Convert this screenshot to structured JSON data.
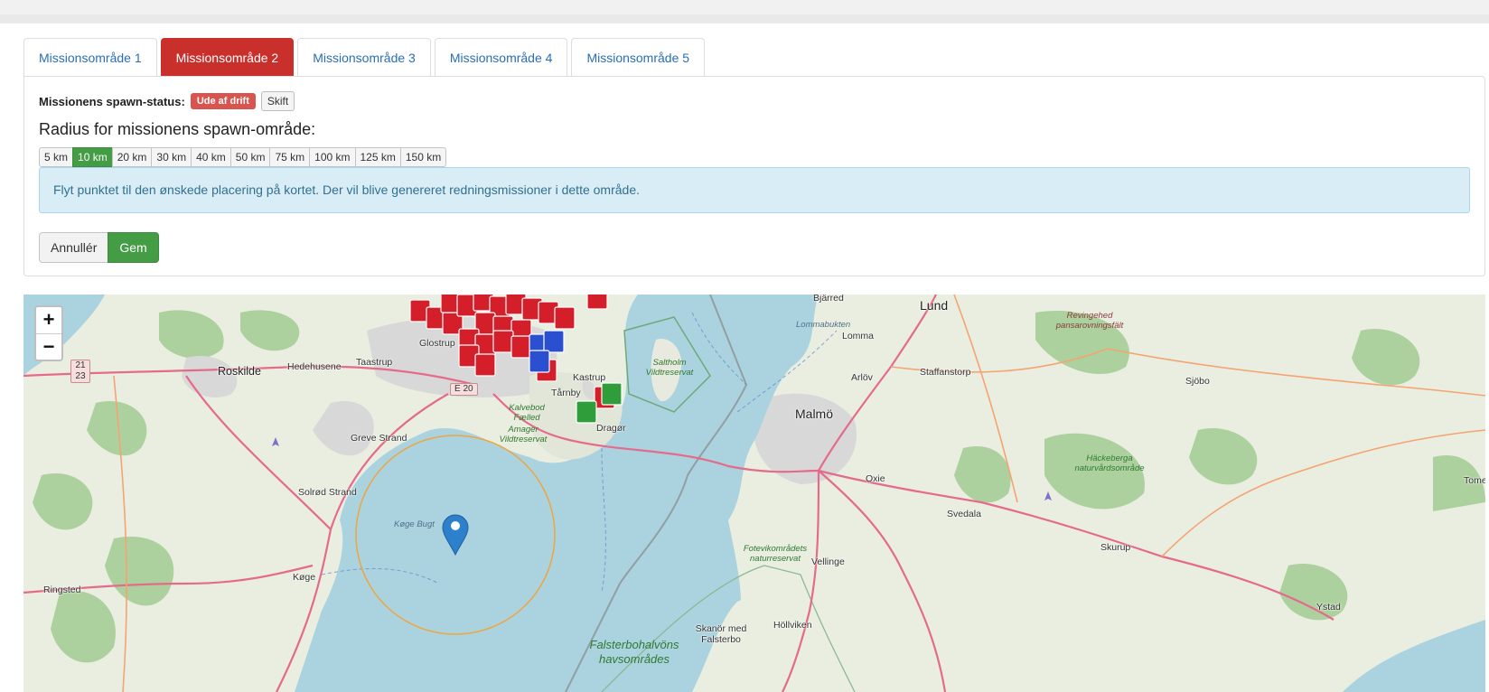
{
  "tabs": [
    {
      "label": "Missionsområde 1",
      "active": false
    },
    {
      "label": "Missionsområde 2",
      "active": true
    },
    {
      "label": "Missionsområde 3",
      "active": false
    },
    {
      "label": "Missionsområde 4",
      "active": false
    },
    {
      "label": "Missionsområde 5",
      "active": false
    }
  ],
  "status": {
    "label": "Missionens spawn-status:",
    "badge": "Ude af drift",
    "toggle_label": "Skift",
    "badge_color": "#d9534f"
  },
  "radius": {
    "title": "Radius for missionens spawn-område:",
    "options": [
      "5 km",
      "10 km",
      "20 km",
      "30 km",
      "40 km",
      "50 km",
      "75 km",
      "100 km",
      "125 km",
      "150 km"
    ],
    "selected": "10 km"
  },
  "info_text": "Flyt punktet til den ønskede placering på kortet. Der vil blive genereret redningsmissioner i dette område.",
  "actions": {
    "cancel_label": "Annullér",
    "save_label": "Gem"
  },
  "map": {
    "zoom_in_label": "+",
    "zoom_out_label": "−",
    "marker_icon": "map-pin-icon",
    "place_labels": {
      "roskilde": "Roskilde",
      "hedehusene": "Hedehusene",
      "taastrup": "Taastrup",
      "glostrup": "Glostrup",
      "kastrup": "Kastrup",
      "taarnby": "Tårnby",
      "dragor": "Dragør",
      "greve": "Greve Strand",
      "solrod": "Solrød Strand",
      "koge": "Køge",
      "ringsted": "Ringsted",
      "koge_bugt": "Køge Bugt",
      "bjarred": "Bjärred",
      "lund": "Lund",
      "lomma": "Lomma",
      "lommabukten": "Lommabukten",
      "arlov": "Arlöv",
      "staffanstorp": "Staffanstorp",
      "malmo": "Malmö",
      "oxie": "Oxie",
      "svedala": "Svedala",
      "skurup": "Skurup",
      "sjobo": "Sjöbo",
      "ystad": "Ystad",
      "vellinge": "Vellinge",
      "hollviken": "Höllviken",
      "skanor": "Skanör med Falsterbo",
      "tomelilla": "Tome",
      "saltholm": "Saltholm Vildtreservat",
      "kalvebod": "Kalvebod Fælled",
      "amager": "Amager Vildtreservat",
      "revingehed": "Revingehed pansarovningsfält",
      "hackeberga": "Häckeberga naturvårdsområde",
      "foteviken": "Fotevikområdets naturreservat",
      "falsterbo": "Falsterbohalvöns havsområdes"
    },
    "road_shields": [
      "21 23",
      "E 20"
    ],
    "colors": {
      "water": "#aad3df",
      "land": "#eaeee1",
      "urban": "#d9d9d9",
      "forest": "#add19e",
      "spawn_radius": "#f0a53c"
    }
  }
}
